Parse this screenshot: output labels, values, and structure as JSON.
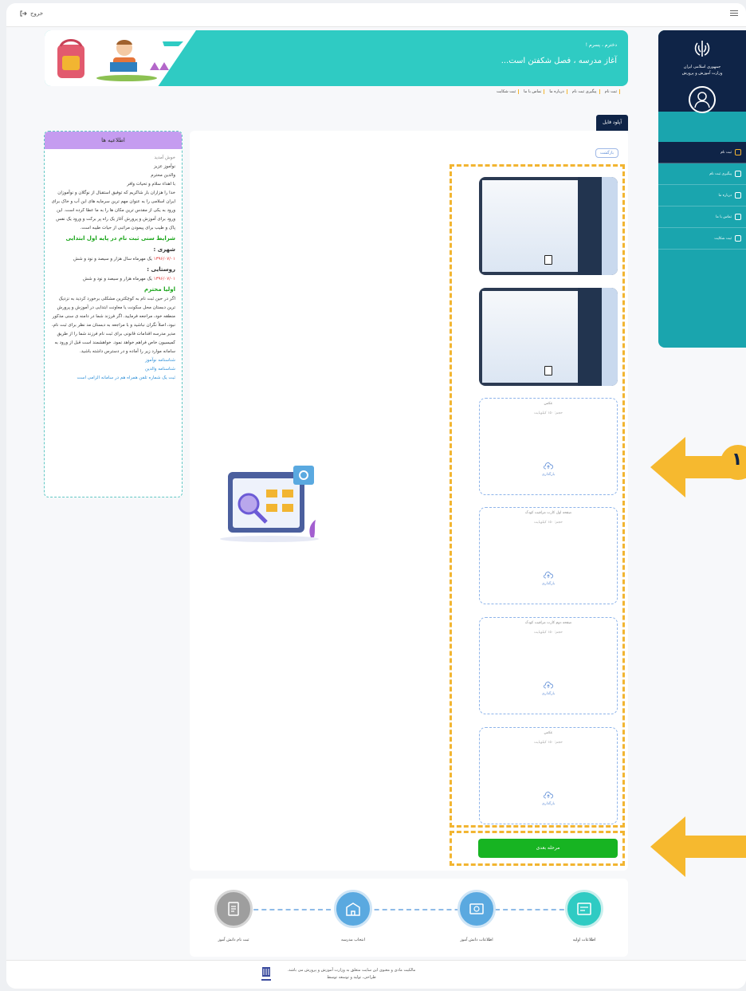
{
  "topbar": {
    "logout_label": "خروج",
    "menu_icon": "menu-icon"
  },
  "sidebar": {
    "org_line1": "جمهوری اسلامی ایران",
    "org_line2": "وزارت آموزش و پرورش",
    "items": [
      {
        "label": "ثبت نام",
        "active": true
      },
      {
        "label": "پیگیری ثبت نام",
        "active": false
      },
      {
        "label": "درباره ما",
        "active": false
      },
      {
        "label": "تماس با ما",
        "active": false
      },
      {
        "label": "ثبت شکایت",
        "active": false
      }
    ]
  },
  "banner": {
    "subtitle": "دخترم ، پسرم !",
    "title": "آغاز مدرسه ، فصل شکفتن است..."
  },
  "breadcrumb": [
    "ثبت نام",
    "پیگیری ثبت نام",
    "درباره ما",
    "تماس با ما",
    "ثبت شکایت"
  ],
  "upload_tab": "آپلود فایل",
  "card": {
    "back_label": "بازگشت",
    "slots": [
      {
        "title": "عکس",
        "hint": "حجم: ۱۵۰ کیلوبایت",
        "upload": "بارگذاری"
      },
      {
        "title": "صفحه اول کارت مراقبت کودک",
        "hint": "حجم: ۱۵۰ کیلوبایت",
        "upload": "بارگذاری"
      },
      {
        "title": "صفحه دوم کارت مراقبت کودک",
        "hint": "حجم: ۱۵۰ کیلوبایت",
        "upload": "بارگذاری"
      },
      {
        "title": "عکس",
        "hint": "حجم: ۱۵۰ کیلوبایت",
        "upload": "بارگذاری"
      }
    ],
    "next_label": "مرحله بعدی"
  },
  "info": {
    "title": "اطلاعیه ها",
    "welcome": "خوش آمدید",
    "l1": "نوآموز عزیز",
    "l2": "والدین محترم",
    "l3": "با اهداء سلام و تحیات وافر",
    "p1": "خدا را هزاران بار شاکریم که توفیق استقبال از نوگلان و نوآموزان ایران اسلامی را به عنوان مهم ترین سرمایه های این آب و خاک برای ورود به یکی از مقدس ترین مکان ها را به ما عطا کرده است. این ورود برای آموزش و پرورش آغاز یک راه پر برکت و ورود یک نفس پاک و طیب برای پیمودن مراتبی از حیات طیبه است.",
    "cond_title": "شرایط سنی ثبت نام در پایه اول ابتدایی",
    "urban": "شهری :",
    "urban_date": "۱۳۹۶/۰۷/۰۱",
    "urban_text": "یک مهرماه سال هزار و سیصد و نود و شش",
    "rural": "روستایی :",
    "rural_date": "۱۳۹۶/۰۷/۰۱",
    "rural_text": "یک مهرماه هزار و سیصد و نود و شش",
    "parents_title": "اولیا محترم",
    "p2": "اگر در حین ثبت نام به کوچکترین مشکلی برخورد کردید به نزدیک ترین دبستان محل سکونت یا معاونت ابتدایی در آموزش و پرورش منطقه خود، مراجعه فرمایید. اگر فرزند شما در دامنه ی سنی مذکور نبود، اصلاً نگران نباشید و با مراجعه به دبستان مد نظر برای ثبت نام، مدیر مدرسه اقدامات قانونی برای ثبت نام فرزند شما را از طریق کمیسیون خاص فراهم خواهد نمود. خواهشمند است قبل از ورود به سامانه موارد زیر را آماده و در دسترس داشته باشید.",
    "link1": "شناسنامه نوآموز",
    "link2": "شناسنامه والدین",
    "link3": "ثبت یک شماره تلفن همراه هم در سامانه الزامی است"
  },
  "steps": [
    {
      "label": "ثبت نام دانش آموز",
      "color": "#9e9e9e"
    },
    {
      "label": "انتخاب مدرسه",
      "color": "#5aa9e0"
    },
    {
      "label": "اطلاعات دانش آموز",
      "color": "#5aa9e0"
    },
    {
      "label": "اطلاعات اولیه",
      "color": "#2fcbc3"
    }
  ],
  "footer": {
    "line1": "مالکیت مادی و معنوی این سایت متعلق به وزارت آموزش و پرورش می باشد.",
    "line2": "طراحی، تولید و توسعه توسط"
  },
  "callout": {
    "number": "۱"
  },
  "colors": {
    "accent": "#2fcbc3",
    "navy": "#0f2447",
    "highlight": "#f2b531",
    "green": "#17b422"
  }
}
